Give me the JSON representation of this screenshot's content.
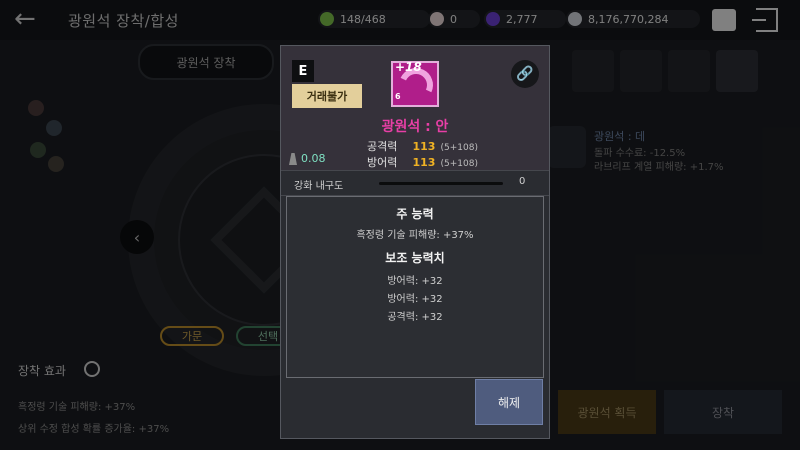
{
  "header": {
    "back_icon": "arrow-left-icon",
    "title": "광원석 장착/합성",
    "currencies": [
      {
        "icon": "green-gem-icon",
        "value": "148/468",
        "color": "#7cc04a"
      },
      {
        "icon": "pearl-icon",
        "value": "0",
        "color": "#e8d6d6"
      },
      {
        "icon": "purple-orb-icon",
        "value": "2,777",
        "color": "#6b3fd1"
      },
      {
        "icon": "silver-coin-icon",
        "value": "8,176,770,284",
        "color": "#cfd3da"
      }
    ],
    "mailbox_icon": "mailbox-icon",
    "exit_icon": "exit-door-icon"
  },
  "background": {
    "tab_label": "광원석 장착",
    "pill_left": "가문",
    "pill_right": "선택",
    "effects_title": "장착 효과",
    "effects_left": [
      "흑정령 기술 피해량: +37%",
      "상위 수정 합성 확률 증가율: +37%"
    ],
    "right_info": {
      "name": "광원석 : 데",
      "line1": "돌파 수수료: -12.5%",
      "line2": "라브리프 계열 피해량: +1.7%"
    },
    "buttons": {
      "acquire": "광원석 획득",
      "equip": "장착"
    }
  },
  "popup": {
    "grade": "E",
    "tradable_label": "거래불가",
    "item_level": "+18",
    "item_badge": "6",
    "item_name": "광원석 : 안",
    "stats": [
      {
        "label": "공격력",
        "value": "113",
        "detail": "(5+108)"
      },
      {
        "label": "방어력",
        "value": "113",
        "detail": "(5+108)"
      }
    ],
    "weight": "0.08",
    "durability_label": "강화 내구도",
    "durability_value": "0",
    "durability_fill": 0,
    "main_title": "주 능력",
    "main_lines": [
      "흑정령 기술 피해량: +37%"
    ],
    "sub_title": "보조 능력치",
    "sub_lines": [
      "방어력: +32",
      "방어력: +32",
      "공격력: +32"
    ],
    "release_label": "해제"
  }
}
